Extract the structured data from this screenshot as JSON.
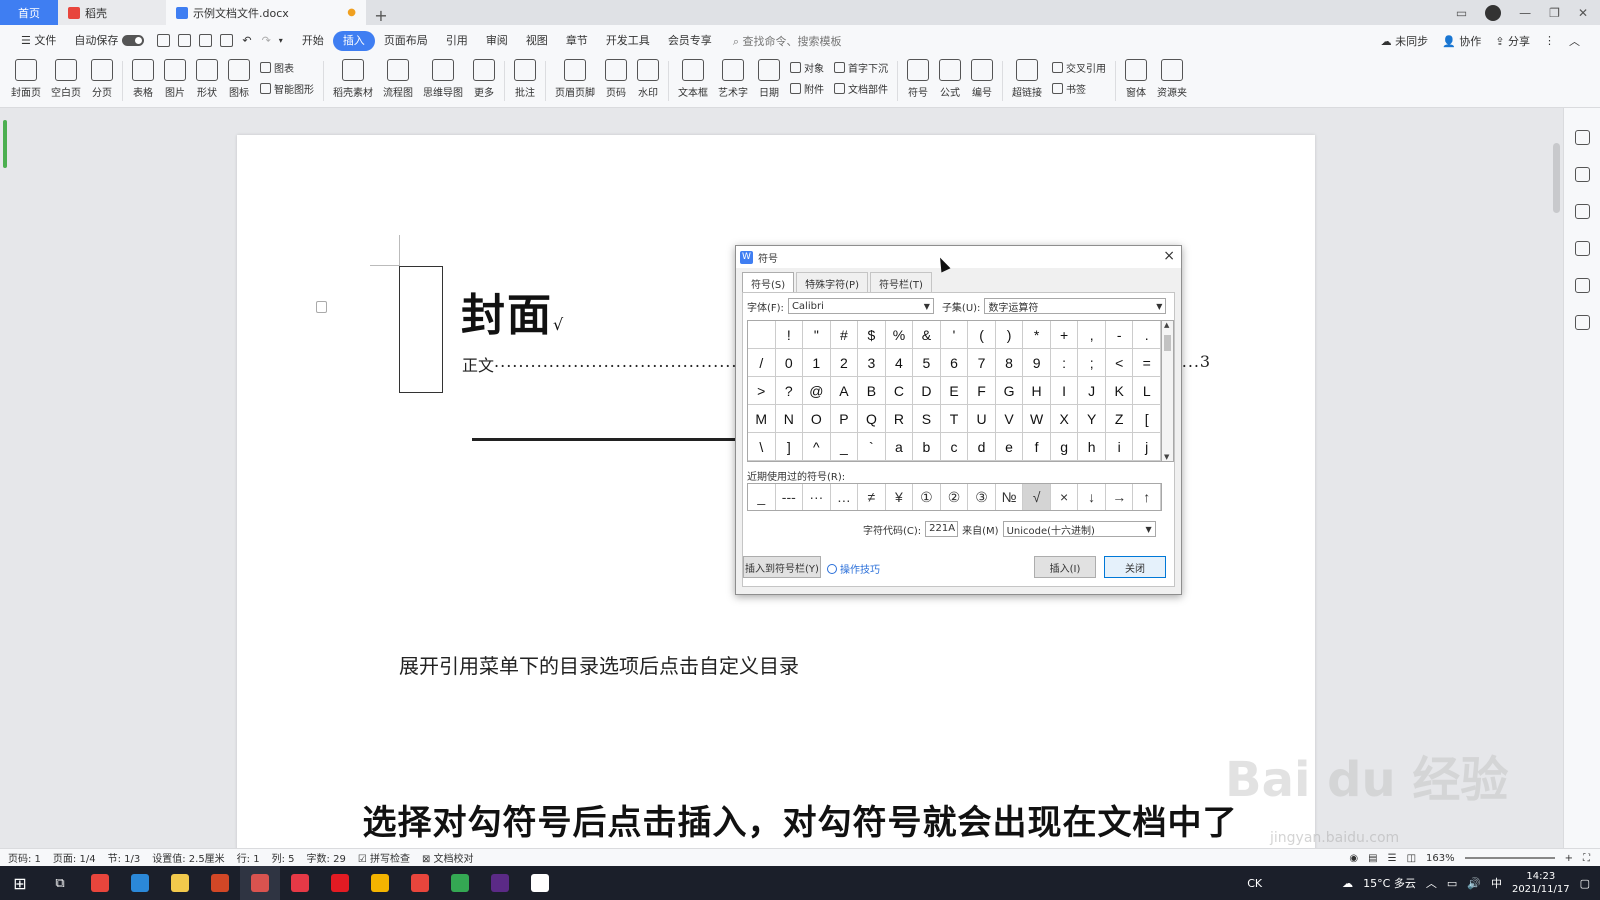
{
  "tabs": {
    "home": "首页",
    "daoke": "稻壳",
    "doc": "示例文档文件.docx",
    "plus": "+"
  },
  "menu": {
    "file": "文件",
    "autosave": "自动保存",
    "items": [
      "开始",
      "插入",
      "页面布局",
      "引用",
      "审阅",
      "视图",
      "章节",
      "开发工具",
      "会员专享"
    ],
    "active": "插入",
    "search": "查找命令、搜索模板",
    "right": [
      "未同步",
      "协作",
      "分享"
    ]
  },
  "ribbon": {
    "big": [
      "封面页",
      "空白页",
      "分页",
      "表格",
      "图片",
      "形状",
      "图标"
    ],
    "col1": [
      "图表",
      "智能图形"
    ],
    "big2": [
      "稻壳素材",
      "流程图",
      "思维导图",
      "更多",
      "批注",
      "页眉页脚",
      "页码",
      "水印",
      "文本框",
      "艺术字",
      "日期"
    ],
    "col2": [
      "对象",
      "附件"
    ],
    "col3": [
      "首字下沉",
      "文档部件"
    ],
    "big3": [
      "符号",
      "公式",
      "编号",
      "超链接"
    ],
    "col4": [
      "交叉引用",
      "书签"
    ],
    "big4": [
      "窗体",
      "资源夹"
    ]
  },
  "document": {
    "cover_title": "封面",
    "check_mark": "√",
    "toc_text": "正文",
    "toc_dots": "..............................................................................................................................................................................................................................................",
    "toc_page": "3",
    "paragraph": "展开引用菜单下的目录选项后点击自定义目录"
  },
  "dialog": {
    "title": "符号",
    "close": "×",
    "tabs": [
      "符号(S)",
      "特殊字符(P)",
      "符号栏(T)"
    ],
    "font_label": "字体(F):",
    "font_value": "Calibri",
    "subset_label": "子集(U):",
    "subset_value": "数字运算符",
    "grid": [
      [
        "",
        "!",
        "\"",
        "#",
        "$",
        "%",
        "&",
        "'",
        "(",
        ")",
        "*",
        "+",
        ",",
        "-",
        "."
      ],
      [
        "/",
        "0",
        "1",
        "2",
        "3",
        "4",
        "5",
        "6",
        "7",
        "8",
        "9",
        ":",
        ";",
        "<",
        "="
      ],
      [
        ">",
        "?",
        "@",
        "A",
        "B",
        "C",
        "D",
        "E",
        "F",
        "G",
        "H",
        "I",
        "J",
        "K",
        "L"
      ],
      [
        "M",
        "N",
        "O",
        "P",
        "Q",
        "R",
        "S",
        "T",
        "U",
        "V",
        "W",
        "X",
        "Y",
        "Z",
        "["
      ],
      [
        "\\",
        "]",
        "^",
        "_",
        "`",
        "a",
        "b",
        "c",
        "d",
        "e",
        "f",
        "g",
        "h",
        "i",
        "j"
      ]
    ],
    "recent_label": "近期使用过的符号(R):",
    "recent": [
      "_",
      "---",
      "···",
      "…",
      "≠",
      "¥",
      "①",
      "②",
      "③",
      "№",
      "√",
      "×",
      "↓",
      "→",
      "↑"
    ],
    "recent_selected_index": 10,
    "code_label": "字符代码(C):",
    "code_value": "221A",
    "from_label": "来自(M)",
    "from_value": "Unicode(十六进制)",
    "insert_to_bar": "插入到符号栏(Y)",
    "tips": "操作技巧",
    "insert": "插入(I)",
    "close_btn": "关闭"
  },
  "status": {
    "items": [
      "页码: 1",
      "页面: 1/4",
      "节: 1/3",
      "设置值: 2.5厘米",
      "行: 1",
      "列: 5",
      "字数: 29",
      "拼写检查",
      "文档校对"
    ],
    "zoom": "163%"
  },
  "taskbar": {
    "weather": "15°C 多云",
    "ime": "中",
    "ck": "CK",
    "time": "14:23",
    "date": "2021/11/17",
    "apps": [
      {
        "name": "chrome",
        "color": "#e8453c"
      },
      {
        "name": "edge",
        "color": "#2b88d8"
      },
      {
        "name": "folder",
        "color": "#f2c94c"
      },
      {
        "name": "ppt",
        "color": "#d24726"
      },
      {
        "name": "wps-writer",
        "color": "#d9534f"
      },
      {
        "name": "wps",
        "color": "#e63946"
      },
      {
        "name": "netease-music",
        "color": "#e31b23"
      },
      {
        "name": "video",
        "color": "#f4b400"
      },
      {
        "name": "wps-pic",
        "color": "#e8453c"
      },
      {
        "name": "chrome2",
        "color": "#34a853"
      },
      {
        "name": "premiere",
        "color": "#5b2a86"
      },
      {
        "name": "app",
        "color": "#ffffff"
      }
    ]
  },
  "subtitle": "选择对勾符号后点击插入，对勾符号就会出现在文档中了",
  "watermark": "Bai du 经验",
  "watermark_sub": "jingyan.baidu.com",
  "colors": {
    "accent": "#3f7ef2",
    "dialog_primary_border": "#0078d7"
  }
}
